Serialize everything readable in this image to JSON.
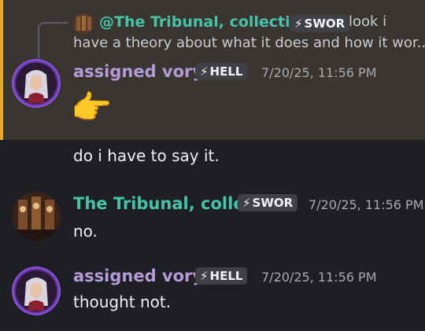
{
  "reply": {
    "author": "@The Tribunal, collectively",
    "tag": "SWOR",
    "text_line1": "look i",
    "text_line2": "have a theory about what it does and how it wor..."
  },
  "messages": [
    {
      "author": "assigned voryn",
      "tag": "HELL",
      "timestamp": "7/20/25, 11:56 PM",
      "content": "👉",
      "avatar": "voryn-avatar",
      "highlighted": true
    },
    {
      "author": null,
      "content": "do i have to say it."
    },
    {
      "author": "The Tribunal, colle...",
      "tag": "SWOR",
      "timestamp": "7/20/25, 11:56 PM",
      "content": "no.",
      "avatar": "tribunal-avatar"
    },
    {
      "author": "assigned voryn",
      "tag": "HELL",
      "timestamp": "7/20/25, 11:56 PM",
      "content": "thought not.",
      "avatar": "voryn-avatar"
    }
  ],
  "colors": {
    "background": "#1e1f24",
    "highlight_bg": "#3a3530",
    "highlight_bar": "#e8a927",
    "voryn_name": "#b69ad8",
    "tribunal_name": "#45c4a8"
  }
}
